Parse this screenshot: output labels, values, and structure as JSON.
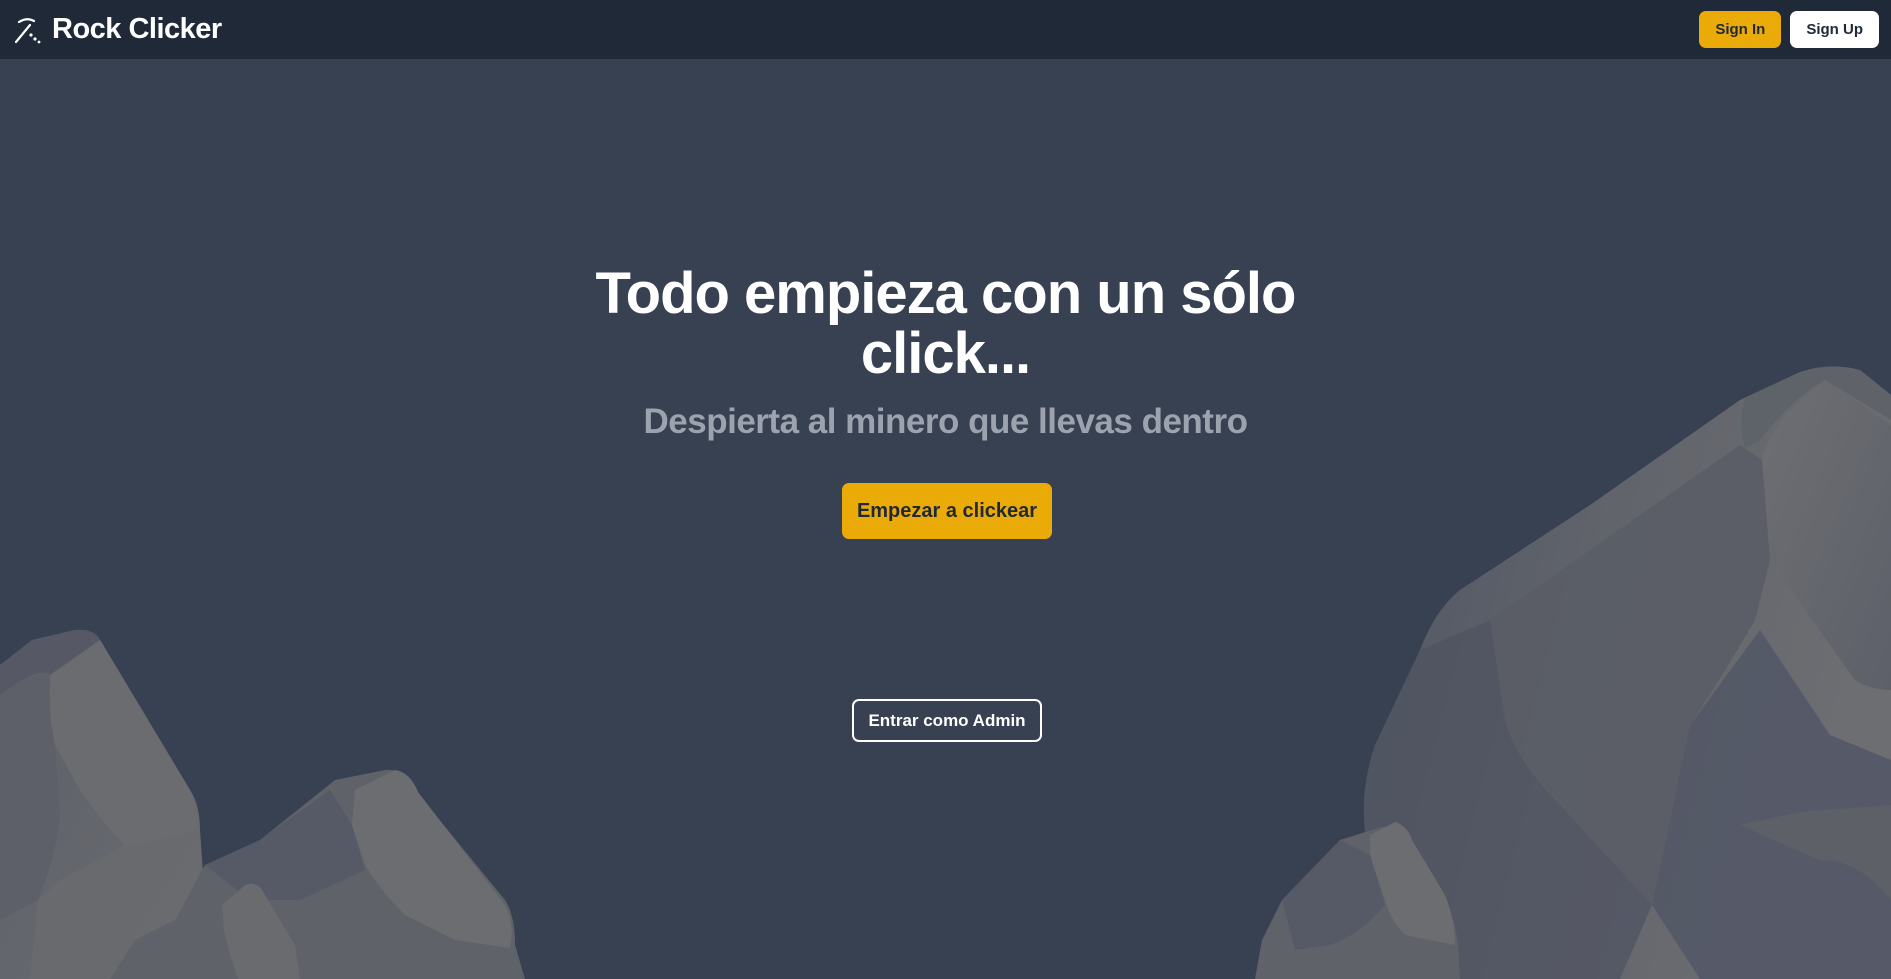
{
  "app": {
    "name": "Rock Clicker",
    "logo_icon": "pickaxe-icon"
  },
  "nav": {
    "sign_in_label": "Sign In",
    "sign_up_label": "Sign Up"
  },
  "hero": {
    "title_line_1": "Todo empieza con un sólo",
    "title_line_2": "click...",
    "subtitle": "Despierta al minero que llevas dentro",
    "cta_label": "Empezar a clickear",
    "admin_label": "Entrar como Admin"
  },
  "colors": {
    "navbar_bg": "#1f2937",
    "page_bg": "#374151",
    "accent": "#eaaa08",
    "subtitle": "#9ca3af",
    "rock_light": "#6b6e74",
    "rock_dark": "#4b5160"
  }
}
